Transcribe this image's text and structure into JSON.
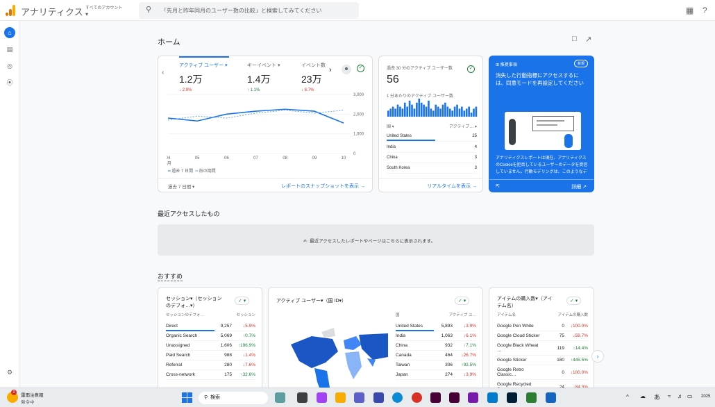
{
  "topbar": {
    "title": "アナリティクス",
    "account_label": "すべてのアカウント",
    "search_placeholder": "「先月と昨年同月のユーザー数の比較」と検索してみてください"
  },
  "home": {
    "title": "ホーム",
    "recent_heading": "最近アクセスしたもの",
    "recent_empty": "最近アクセスしたレポートやページはこちらに表示されます。",
    "recommend_heading": "おすすめ"
  },
  "overview": {
    "kpis": [
      {
        "label": "アクティブ ユーザー",
        "value": "1.2万",
        "change": "2.9%",
        "direction": "down"
      },
      {
        "label": "キーイベント",
        "value": "1.4万",
        "change": "1.1%",
        "direction": "up"
      },
      {
        "label": "イベント数",
        "value": "23万",
        "change": "8.7%",
        "direction": "down"
      }
    ],
    "y_ticks": [
      "3,000",
      "2,000",
      "1,000",
      "0"
    ],
    "x_ticks": [
      "04",
      "05",
      "06",
      "07",
      "08",
      "09",
      "10"
    ],
    "x_sub": "4月",
    "legend_current": "過去 7 日間",
    "legend_prev": "前の期間",
    "period": "過去 7 日間",
    "link": "レポートのスナップショットを表示"
  },
  "chart_data": {
    "type": "line",
    "x": [
      "04",
      "05",
      "06",
      "07",
      "08",
      "09",
      "10"
    ],
    "ylim": [
      0,
      3000
    ],
    "series": [
      {
        "name": "過去 7 日間",
        "values": [
          1800,
          1650,
          2000,
          2150,
          2250,
          2150,
          1550
        ]
      },
      {
        "name": "前の期間",
        "values": [
          1700,
          1900,
          1800,
          2050,
          2200,
          2050,
          2200
        ]
      }
    ]
  },
  "realtime": {
    "title": "過去 30 分のアクティブ ユーザー数",
    "value": "56",
    "sub": "1 分あたりのアクティブ ユーザー数",
    "bars": [
      3,
      4,
      5,
      4,
      6,
      5,
      4,
      7,
      5,
      8,
      6,
      4,
      7,
      9,
      7,
      6,
      5,
      8,
      4,
      3,
      6,
      5,
      4,
      6,
      7,
      5,
      4,
      3,
      5,
      6,
      4,
      5,
      3,
      4,
      5,
      2,
      4,
      5
    ],
    "col1": "国",
    "col2": "アクティブ…",
    "rows": [
      {
        "country": "United States",
        "value": "25"
      },
      {
        "country": "India",
        "value": "4"
      },
      {
        "country": "China",
        "value": "3"
      },
      {
        "country": "South Korea",
        "value": "3"
      }
    ],
    "link": "リアルタイムを表示"
  },
  "insight": {
    "tag": "推奨事項",
    "badge": "新規",
    "title": "消失した行動指標にアクセスするには、同意モードを再設定してください",
    "body": "アナリティクスレポートは現在、アナリティクスのCookieを拒否しているユーザーのデータを受信していません。行動モデリングは、このようなデータギャップを埋めるため…",
    "link": "詳細"
  },
  "rec1": {
    "title": "セッション▾（セッションのデフォ…▾）",
    "col1": "セッションのデフォ…",
    "col2": "セッション",
    "rows": [
      {
        "name": "Direct",
        "value": "9,257",
        "change": "5.9%",
        "direction": "down"
      },
      {
        "name": "Organic Search",
        "value": "5,069",
        "change": "0.7%",
        "direction": "up"
      },
      {
        "name": "Unassigned",
        "value": "1,606",
        "change": "196.9%",
        "direction": "up"
      },
      {
        "name": "Paid Search",
        "value": "988",
        "change": "1.4%",
        "direction": "down"
      },
      {
        "name": "Referral",
        "value": "280",
        "change": "7.6%",
        "direction": "down"
      },
      {
        "name": "Cross-network",
        "value": "175",
        "change": "32.6%",
        "direction": "up"
      }
    ]
  },
  "rec2": {
    "title": "アクティブ ユーザー▾（国 ID▾）",
    "col1": "国",
    "col2": "アクティブ ユ…",
    "rows": [
      {
        "name": "United States",
        "value": "5,893",
        "change": "3.9%",
        "direction": "down"
      },
      {
        "name": "India",
        "value": "1,063",
        "change": "6.1%",
        "direction": "down"
      },
      {
        "name": "China",
        "value": "932",
        "change": "7.1%",
        "direction": "up"
      },
      {
        "name": "Canada",
        "value": "464",
        "change": "26.7%",
        "direction": "down"
      },
      {
        "name": "Taiwan",
        "value": "306",
        "change": "92.5%",
        "direction": "up"
      },
      {
        "name": "Japan",
        "value": "274",
        "change": "3.9%",
        "direction": "down"
      }
    ]
  },
  "rec3": {
    "title": "アイテムの購入数▾（アイテム名）",
    "col1": "アイテム名",
    "col2": "アイテムの購入数",
    "rows": [
      {
        "name": "Google Pen White",
        "value": "0",
        "change": "100.0%",
        "direction": "down"
      },
      {
        "name": "Google Cloud Sticker",
        "value": "75",
        "change": "59.7%",
        "direction": "down"
      },
      {
        "name": "Google Black Wheat …",
        "value": "119",
        "change": "14.4%",
        "direction": "up"
      },
      {
        "name": "Google Sticker",
        "value": "180",
        "change": "445.5%",
        "direction": "up"
      },
      {
        "name": "Google Retro Classic…",
        "value": "0",
        "change": "100.0%",
        "direction": "down"
      },
      {
        "name": "Google Recycled Can…",
        "value": "24",
        "change": "84.3%",
        "direction": "down"
      }
    ]
  },
  "taskbar": {
    "weather_title": "雷雨注意報",
    "weather_sub": "発令中",
    "weather_badge": "2",
    "search": "検索",
    "ime": "あ",
    "year": "2025"
  }
}
